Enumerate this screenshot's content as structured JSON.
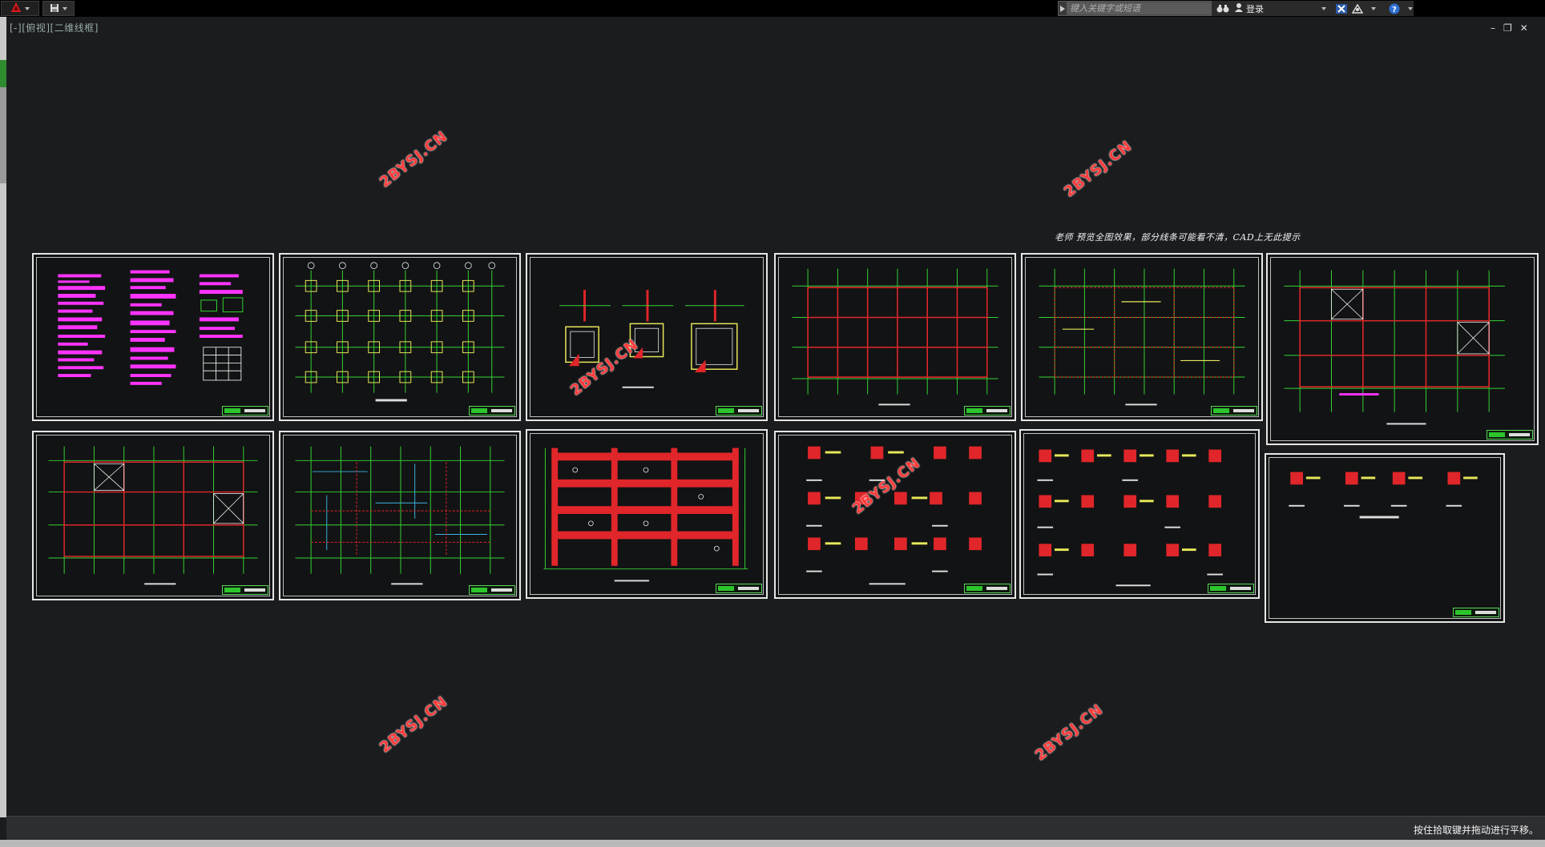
{
  "titlebar": {
    "search_placeholder": "键入关键字或短语",
    "login_label": "登录"
  },
  "viewport": {
    "label": "[-][俯视][二维线框]",
    "window_controls": [
      "–",
      "❐",
      "✕"
    ]
  },
  "note": {
    "text": "老师  预览全图效果，部分线条可能看不清，CAD上无此提示"
  },
  "watermark": {
    "text": "2BYSJ.CN"
  },
  "statusbar": {
    "message": "按住拾取键并拖动进行平移。"
  },
  "colors": {
    "background": "#1b1c1e",
    "grid_green": "#33d433",
    "beam_red": "#e0262a",
    "magenta_text": "#ff33ff",
    "title_green": "#2cc52c",
    "watermark_red": "#ff3c3c"
  },
  "icons": {
    "app_menu": "autocad-logo-icon",
    "qat": "save-icon",
    "search_arrow": "triangle-right-icon",
    "binoculars": "binoculars-icon",
    "user": "user-icon",
    "exchange": "x-icon",
    "connect": "network-icon",
    "help": "help-icon"
  }
}
